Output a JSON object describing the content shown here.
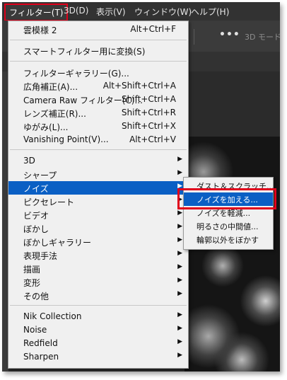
{
  "menubar": {
    "items": [
      "フィルター(T)",
      "3D(D)",
      "表示(V)",
      "ウィンドウ(W)",
      "ヘルプ(H)"
    ]
  },
  "optionsbar": {
    "more": "•••",
    "mode": "3D モード"
  },
  "filter_menu": {
    "last_filter": {
      "label": "雲模様 2",
      "shortcut": "Alt+Ctrl+F"
    },
    "smart_filter": "スマートフィルター用に変換(S)",
    "group2": [
      {
        "label": "フィルターギャラリー(G)...",
        "shortcut": ""
      },
      {
        "label": "広角補正(A)...",
        "shortcut": "Alt+Shift+Ctrl+A"
      },
      {
        "label": "Camera Raw フィルター(C)...",
        "shortcut": "Shift+Ctrl+A"
      },
      {
        "label": "レンズ補正(R)...",
        "shortcut": "Shift+Ctrl+R"
      },
      {
        "label": "ゆがみ(L)...",
        "shortcut": "Shift+Ctrl+X"
      },
      {
        "label": "Vanishing Point(V)...",
        "shortcut": "Alt+Ctrl+V"
      }
    ],
    "group3": [
      "3D",
      "シャープ",
      "ノイズ",
      "ピクセレート",
      "ビデオ",
      "ぼかし",
      "ぼかしギャラリー",
      "表現手法",
      "描画",
      "変形",
      "その他"
    ],
    "group4": [
      "Nik Collection",
      "Noise",
      "Redfield",
      "Sharpen"
    ]
  },
  "noise_submenu": {
    "items": [
      "ダスト＆スクラッチ...",
      "ノイズを加える...",
      "ノイズを軽減...",
      "明るさの中間値...",
      "輪郭以外をぼかす"
    ]
  },
  "colors": {
    "highlight": "#0a5fc4",
    "callout": "#e0001b"
  }
}
